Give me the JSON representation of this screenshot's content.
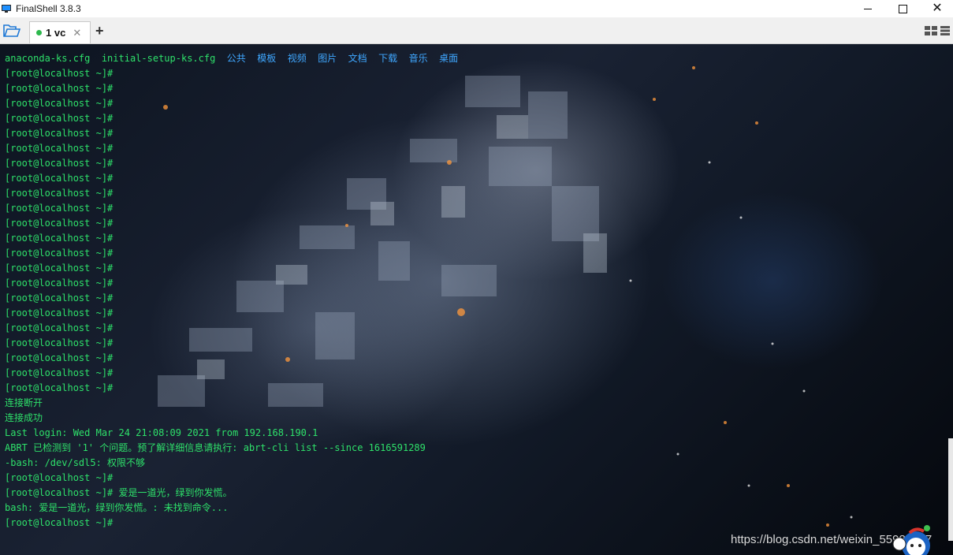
{
  "window": {
    "title": "FinalShell 3.8.3",
    "controls": {
      "minimize": "minimize-icon",
      "maximize": "maximize-icon",
      "close": "close-icon"
    }
  },
  "tabs": [
    {
      "label": "1 vc",
      "status_color": "#2db84d",
      "active": true
    }
  ],
  "toolbar": {
    "add_tab": "+"
  },
  "terminal": {
    "ls_output": [
      "anaconda-ks.cfg",
      "initial-setup-ks.cfg",
      "公共",
      "模板",
      "视频",
      "图片",
      "文档",
      "下载",
      "音乐",
      "桌面"
    ],
    "lines": [
      "[root@localhost ~]#",
      "[root@localhost ~]#",
      "[root@localhost ~]#",
      "[root@localhost ~]#",
      "[root@localhost ~]#",
      "[root@localhost ~]#",
      "[root@localhost ~]#",
      "[root@localhost ~]#",
      "[root@localhost ~]#",
      "[root@localhost ~]#",
      "[root@localhost ~]#",
      "[root@localhost ~]#",
      "[root@localhost ~]#",
      "[root@localhost ~]#",
      "[root@localhost ~]#",
      "[root@localhost ~]#",
      "[root@localhost ~]#",
      "[root@localhost ~]#",
      "[root@localhost ~]#",
      "[root@localhost ~]#",
      "[root@localhost ~]#",
      "[root@localhost ~]#",
      "连接断开",
      "连接成功",
      "Last login: Wed Mar 24 21:08:09 2021 from 192.168.190.1",
      "ABRT 已检测到 '1' 个问题。预了解详细信息请执行: abrt-cli list --since 1616591289",
      "-bash: /dev/sdl5: 权限不够",
      "[root@localhost ~]#",
      "[root@localhost ~]# 爱是一道光，绿到你发慌。",
      "bash: 爱是一道光，绿到你发慌。: 未找到命令...",
      "[root@localhost ~]#"
    ],
    "text_color": "#2ee06a",
    "dir_color": "#3fa7ff"
  },
  "watermark": "https://blog.csdn.net/weixin_55985097"
}
